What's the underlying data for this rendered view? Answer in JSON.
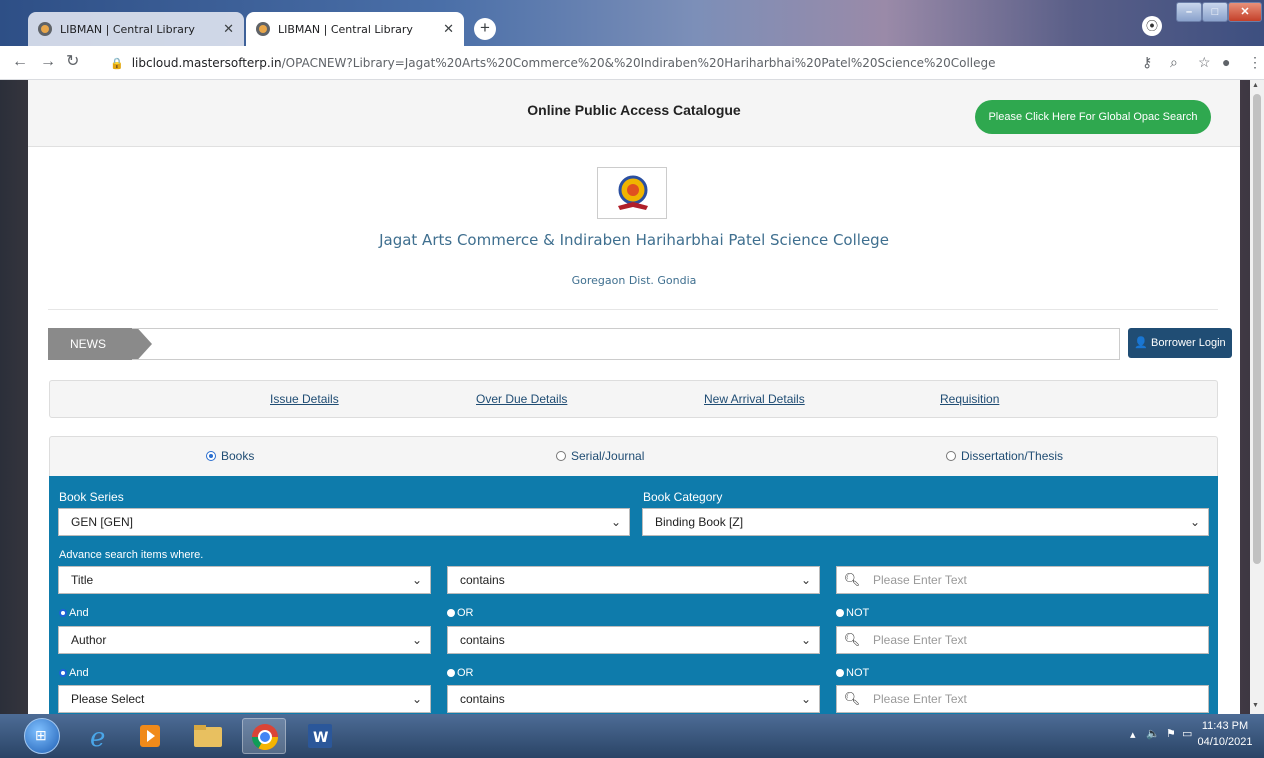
{
  "browser": {
    "tabs": [
      {
        "title": "LIBMAN | Central Library",
        "active": false
      },
      {
        "title": "LIBMAN | Central Library",
        "active": true
      }
    ],
    "new_tab_label": "+",
    "url_domain": "libcloud.mastersofterp.in",
    "url_path": "/OPACNEW?Library=Jagat%20Arts%20Commerce%20&%20Indiraben%20Hariharbhai%20Patel%20Science%20College"
  },
  "page": {
    "header_title": "Online Public Access Catalogue",
    "global_search_button": "Please Click Here For Global Opac Search",
    "college_name": "Jagat Arts Commerce & Indiraben Hariharbhai Patel Science College",
    "college_address": "Goregaon Dist. Gondia",
    "news_label": "NEWS",
    "borrower_login": "Borrower Login",
    "links": [
      "Issue Details",
      "Over Due Details",
      "New Arrival Details",
      "Requisition"
    ],
    "material_types": [
      {
        "label": "Books",
        "selected": true
      },
      {
        "label": "Serial/Journal",
        "selected": false
      },
      {
        "label": "Dissertation/Thesis",
        "selected": false
      }
    ],
    "search": {
      "book_series_label": "Book Series",
      "book_series_value": "GEN [GEN]",
      "book_category_label": "Book Category",
      "book_category_value": "Binding Book [Z]",
      "advance_label": "Advance search items where.",
      "rows": [
        {
          "field": "Title",
          "operator": "contains",
          "placeholder": "Please Enter Text"
        },
        {
          "field": "Author",
          "operator": "contains",
          "placeholder": "Please Enter Text"
        },
        {
          "field": "Please Select",
          "operator": "contains",
          "placeholder": "Please Enter Text"
        }
      ],
      "logic_options": [
        "And",
        "OR",
        "NOT"
      ]
    }
  },
  "taskbar": {
    "clock_time": "11:43 PM",
    "clock_date": "04/10/2021"
  },
  "colors": {
    "panel_blue": "#0e7bab",
    "link_blue": "#204d74",
    "global_btn_green": "#2fa84f",
    "title_teal": "#3f6f8f"
  }
}
